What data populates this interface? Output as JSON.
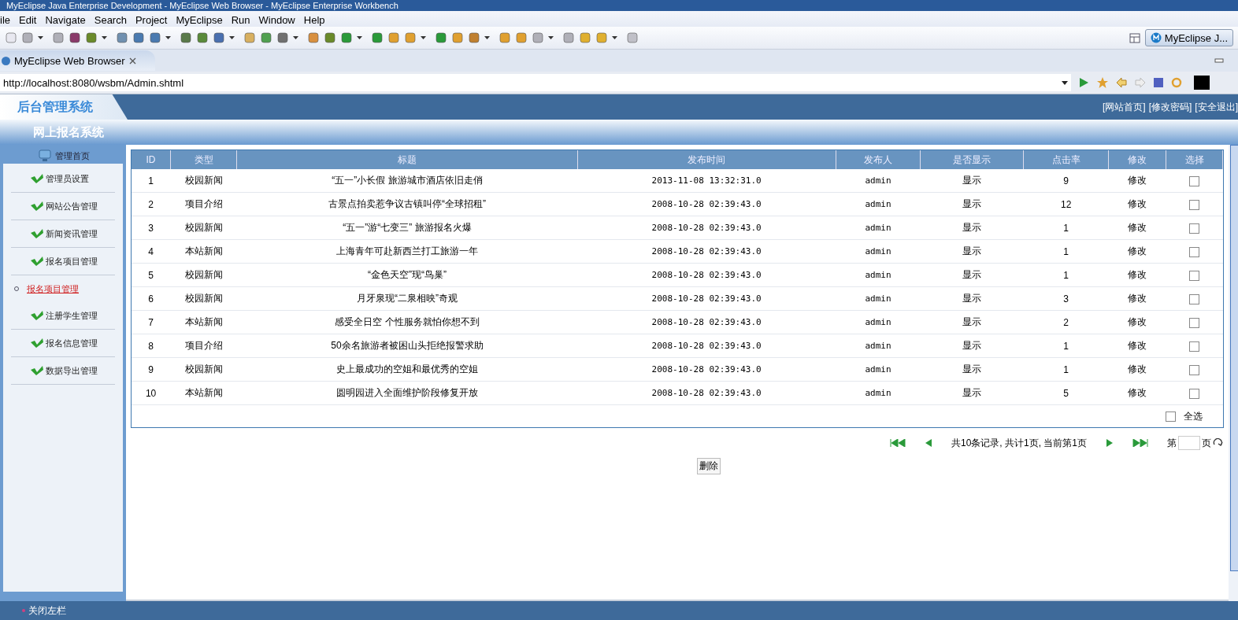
{
  "window": {
    "title": "MyEclipse Java Enterprise Development - MyEclipse Web Browser - MyEclipse Enterprise Workbench"
  },
  "menu": [
    "ile",
    "Edit",
    "Navigate",
    "Search",
    "Project",
    "MyEclipse",
    "Run",
    "Window",
    "Help"
  ],
  "perspective": {
    "label": "MyEclipse J..."
  },
  "editor_tab": {
    "label": "MyEclipse Web Browser"
  },
  "browser": {
    "url": "http://localhost:8080/wsbm/Admin.shtml"
  },
  "page": {
    "logo": "后台管理系统",
    "header_links": [
      "[网站首页]",
      "[修改密码]",
      "[安全退出]"
    ],
    "system_title": "网上报名系统",
    "sidebar": {
      "home": "管理首页",
      "items": [
        {
          "label": "管理员设置",
          "selected": false
        },
        {
          "label": "网站公告管理",
          "selected": false
        },
        {
          "label": "新闻资讯管理",
          "selected": false
        },
        {
          "label": "报名项目管理",
          "selected": false
        },
        {
          "label": "报名项目管理",
          "selected": true
        },
        {
          "label": "注册学生管理",
          "selected": false
        },
        {
          "label": "报名信息管理",
          "selected": false
        },
        {
          "label": "数据导出管理",
          "selected": false
        }
      ]
    },
    "table": {
      "columns": [
        "ID",
        "类型",
        "标题",
        "发布时间",
        "发布人",
        "是否显示",
        "点击率",
        "修改",
        "选择"
      ],
      "rows": [
        {
          "cells": [
            "1",
            "校园新闻",
            "“五一”小长假 旅游城市酒店依旧走俏",
            "2013-11-08 13:32:31.0",
            "admin",
            "显示",
            "9",
            "修改"
          ],
          "checked": false
        },
        {
          "cells": [
            "2",
            "项目介绍",
            "古景点拍卖惹争议古镇叫停“全球招租”",
            "2008-10-28 02:39:43.0",
            "admin",
            "显示",
            "12",
            "修改"
          ],
          "checked": false
        },
        {
          "cells": [
            "3",
            "校园新闻",
            "“五一”游“七变三” 旅游报名火爆",
            "2008-10-28 02:39:43.0",
            "admin",
            "显示",
            "1",
            "修改"
          ],
          "checked": false
        },
        {
          "cells": [
            "4",
            "本站新闻",
            "上海青年可赴新西兰打工旅游一年",
            "2008-10-28 02:39:43.0",
            "admin",
            "显示",
            "1",
            "修改"
          ],
          "checked": false
        },
        {
          "cells": [
            "5",
            "校园新闻",
            "“金色天空”现“鸟巢”",
            "2008-10-28 02:39:43.0",
            "admin",
            "显示",
            "1",
            "修改"
          ],
          "checked": false
        },
        {
          "cells": [
            "6",
            "校园新闻",
            "月牙泉现“二泉相映”奇观",
            "2008-10-28 02:39:43.0",
            "admin",
            "显示",
            "3",
            "修改"
          ],
          "checked": false
        },
        {
          "cells": [
            "7",
            "本站新闻",
            "感受全日空 个性服务就怕你想不到",
            "2008-10-28 02:39:43.0",
            "admin",
            "显示",
            "2",
            "修改"
          ],
          "checked": false
        },
        {
          "cells": [
            "8",
            "项目介绍",
            "50余名旅游者被困山头拒绝报警求助",
            "2008-10-28 02:39:43.0",
            "admin",
            "显示",
            "1",
            "修改"
          ],
          "checked": false
        },
        {
          "cells": [
            "9",
            "校园新闻",
            "史上最成功的空姐和最优秀的空姐",
            "2008-10-28 02:39:43.0",
            "admin",
            "显示",
            "1",
            "修改"
          ],
          "checked": false
        },
        {
          "cells": [
            "10",
            "本站新闻",
            "圆明园进入全面维护阶段修复开放",
            "2008-10-28 02:39:43.0",
            "admin",
            "显示",
            "5",
            "修改"
          ],
          "checked": false
        }
      ],
      "select_all": {
        "label": "全选",
        "checked": false
      }
    },
    "pager": {
      "summary": "共10条记录, 共计1页, 当前第1页",
      "page_prefix": "第",
      "page_suffix": "页"
    },
    "delete_button": "删除",
    "footer": "关闭左栏"
  }
}
